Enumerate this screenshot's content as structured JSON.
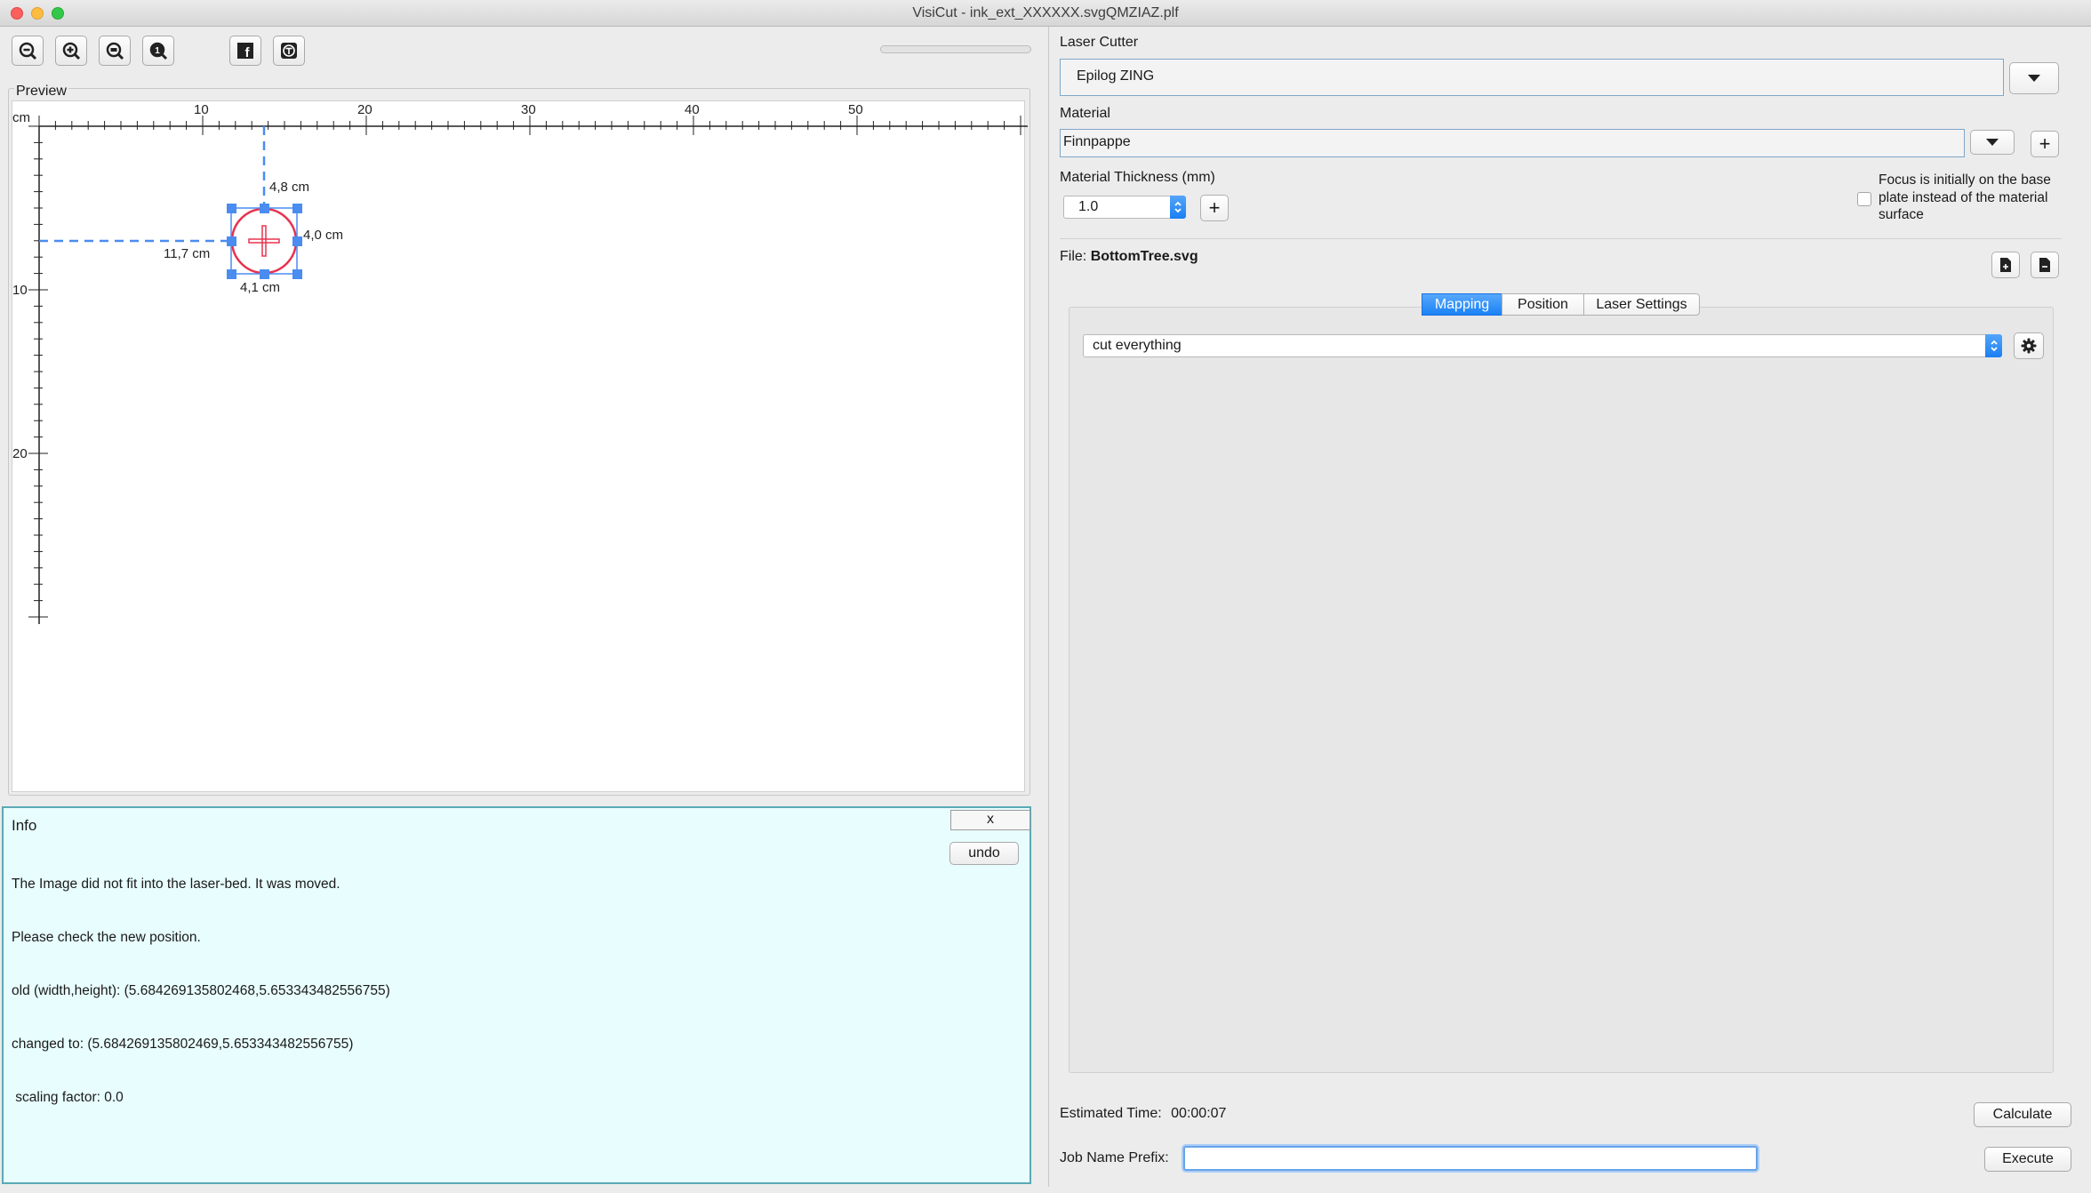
{
  "window": {
    "title": "VisiCut - ink_ext_XXXXXX.svgQMZIAZ.plf"
  },
  "toolbar": {
    "buttons": [
      "zoom-out-icon",
      "zoom-in-icon",
      "zoom-fit-icon",
      "zoom-100-icon",
      "facebook-icon",
      "thingiverse-icon"
    ]
  },
  "preview": {
    "legend": "Preview",
    "unit": "cm",
    "x_ticks": [
      "10",
      "20",
      "30",
      "40",
      "50"
    ],
    "y_ticks": [
      "10",
      "20"
    ],
    "dim_top": "4,8 cm",
    "dim_left": "11,7 cm",
    "dim_right": "4,0 cm",
    "dim_bottom": "4,1 cm"
  },
  "info": {
    "title": "Info",
    "close_label": "x",
    "undo_label": "undo",
    "lines": [
      "The Image did not fit into the laser-bed. It was moved.",
      "Please check the new position.",
      "old (width,height): (5.684269135802468,5.653343482556755)",
      "changed to: (5.684269135802469,5.653343482556755)",
      " scaling factor: 0.0"
    ]
  },
  "settings": {
    "laser_cutter_label": "Laser Cutter",
    "laser_cutter_value": "Epilog ZING",
    "material_label": "Material",
    "material_value": "Finnpappe",
    "thickness_label": "Material Thickness (mm)",
    "thickness_value": "1.0",
    "focus_label": "Focus is initially on the base plate instead of the material surface",
    "focus_checked": false,
    "file_prefix": "File:",
    "file_name": "BottomTree.svg",
    "tabs": [
      "Mapping",
      "Position",
      "Laser Settings"
    ],
    "active_tab": "Mapping",
    "mapping_value": "cut everything",
    "estimated_label": "Estimated Time:",
    "estimated_value": "00:00:07",
    "calculate_label": "Calculate",
    "job_prefix_label": "Job Name Prefix:",
    "job_prefix_value": "",
    "execute_label": "Execute"
  },
  "colors": {
    "accent": "#1a82f5",
    "info_bg": "#e8fdfe",
    "selection": "#4a8cf0",
    "shape": "#e8334f"
  }
}
